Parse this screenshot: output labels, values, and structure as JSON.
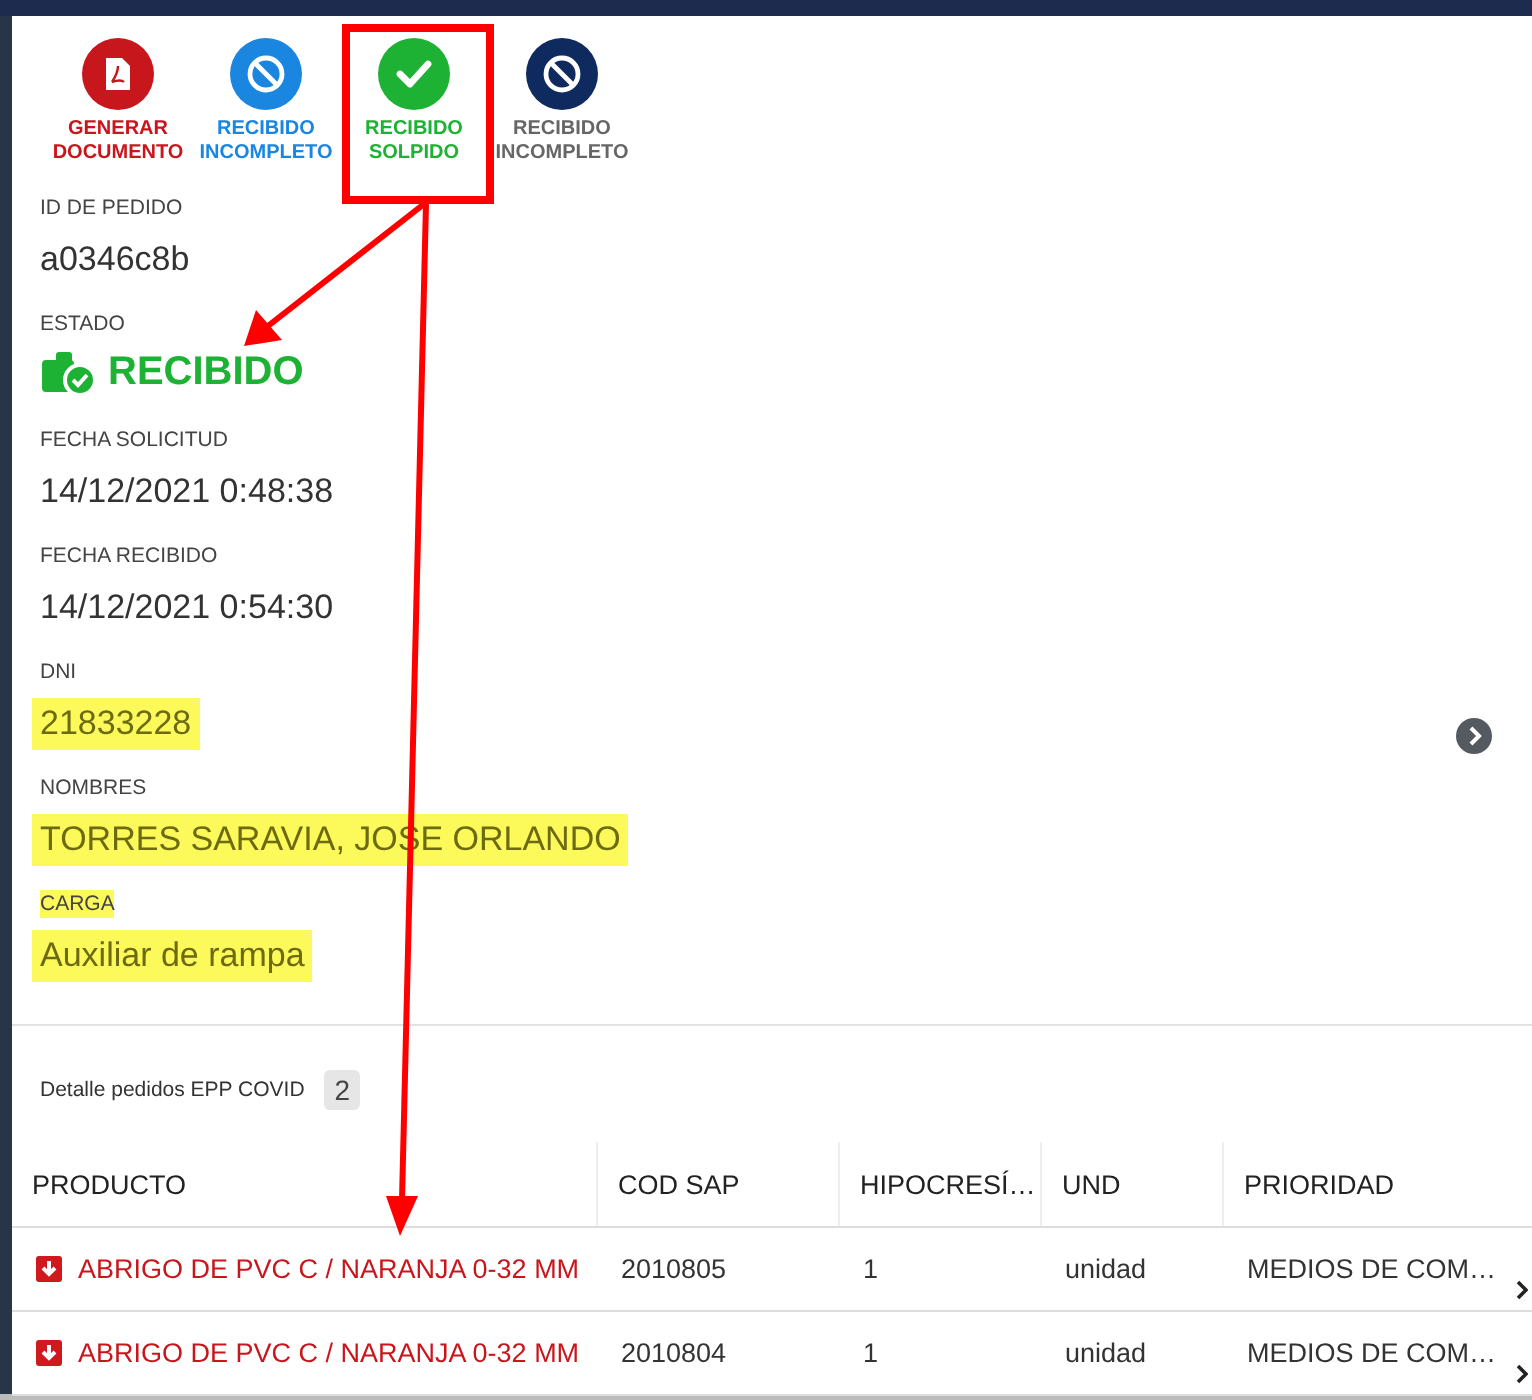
{
  "actions": [
    {
      "kind": "pdf",
      "color": "#c8161d",
      "muted": false,
      "label_lines": [
        "GENERAR",
        "DOCUMENTO"
      ]
    },
    {
      "kind": "ban",
      "color": "#1a86e0",
      "muted": false,
      "label_lines": [
        "RECIBIDO",
        "INCOMPLETO"
      ]
    },
    {
      "kind": "check",
      "color": "#1db233",
      "muted": false,
      "label_lines": [
        "RECIBIDO",
        "SOLPIDO"
      ]
    },
    {
      "kind": "ban",
      "color": "#0f2a5e",
      "muted": true,
      "label_lines": [
        "RECIBIDO",
        "INCOMPLETO"
      ]
    }
  ],
  "fields": [
    {
      "kind": "text",
      "label": "ID DE PEDIDO",
      "value": "a0346c8b",
      "label_highlighted": false,
      "value_highlighted": false
    },
    {
      "kind": "status",
      "label": "ESTADO",
      "value": "RECIBIDO",
      "label_highlighted": false,
      "value_highlighted": false
    },
    {
      "kind": "text",
      "label": "FECHA SOLICITUD",
      "value": "14/12/2021 0:48:38",
      "label_highlighted": false,
      "value_highlighted": false
    },
    {
      "kind": "text",
      "label": "FECHA RECIBIDO",
      "value": "14/12/2021 0:54:30",
      "label_highlighted": false,
      "value_highlighted": false
    },
    {
      "kind": "text",
      "label": "DNI",
      "value": "21833228",
      "label_highlighted": false,
      "value_highlighted": true
    },
    {
      "kind": "text",
      "label": "NOMBRES",
      "value": "TORRES SARAVIA, JOSE ORLANDO",
      "label_highlighted": false,
      "value_highlighted": true
    },
    {
      "kind": "text",
      "label": "CARGA",
      "value": "Auxiliar de rampa",
      "label_highlighted": true,
      "value_highlighted": true
    }
  ],
  "detail": {
    "title": "Detalle pedidos EPP COVID",
    "count": "2"
  },
  "table": {
    "columns": [
      "PRODUCTO",
      "COD SAP",
      "HIPOCRESÍ…",
      "UND",
      "PRIORIDAD"
    ],
    "rows": [
      {
        "cells": [
          "ABRIGO DE PVC C / NARANJA 0-32 MM",
          "2010805",
          "1",
          "unidad",
          "MEDIOS DE COM…"
        ]
      },
      {
        "cells": [
          "ABRIGO DE PVC C / NARANJA 0-32 MM",
          "2010804",
          "1",
          "unidad",
          "MEDIOS DE COM…"
        ]
      }
    ]
  }
}
